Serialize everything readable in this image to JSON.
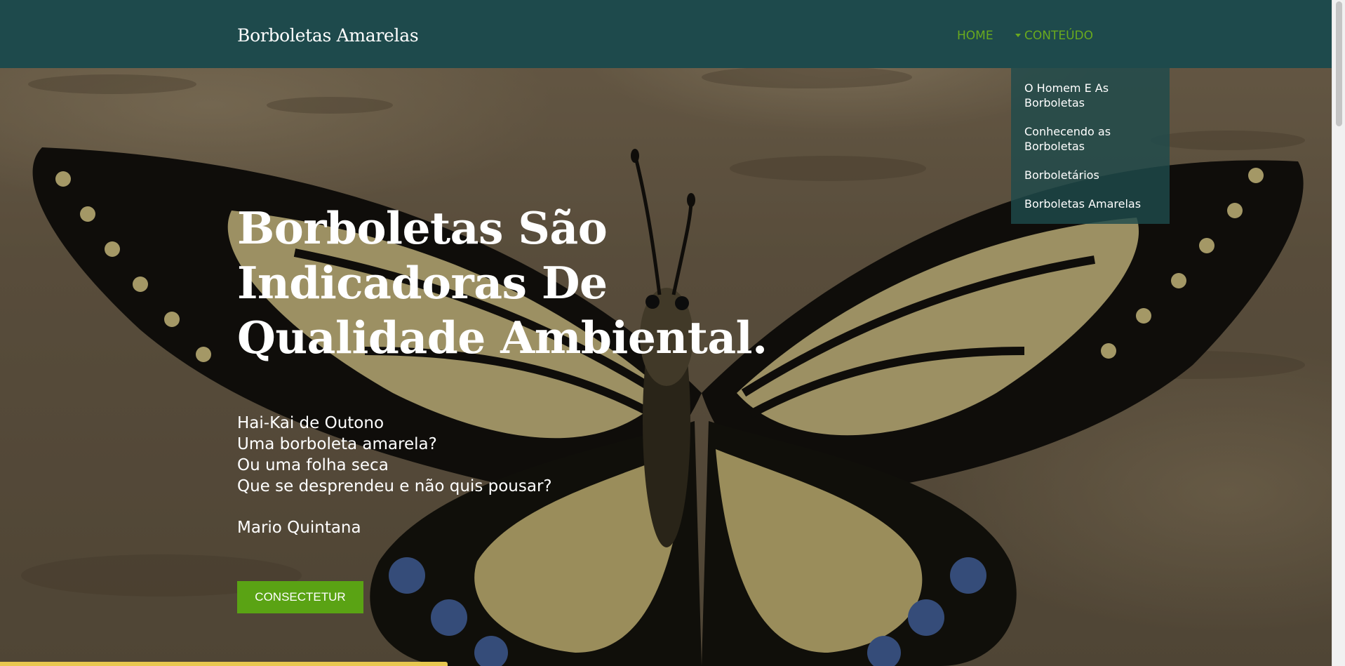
{
  "navbar": {
    "brand": "Borboletas Amarelas",
    "home_label": "HOME",
    "content_label": "CONTEÚDO"
  },
  "dropdown": {
    "items": [
      {
        "label": "O Homem E As Borboletas"
      },
      {
        "label": "Conhecendo as Borboletas"
      },
      {
        "label": "Borboletários"
      },
      {
        "label": "Borboletas Amarelas"
      }
    ]
  },
  "hero": {
    "headline": "Borboletas São Indicadoras De Qualidade Ambiental.",
    "poem_lines": [
      "Hai-Kai de Outono",
      "Uma borboleta amarela?",
      "Ou uma folha seca",
      "Que se desprendeu e não quis pousar?"
    ],
    "author": "Mario Quintana",
    "button_label": "CONSECTETUR"
  },
  "colors": {
    "navbar_bg": "#1e4a4c",
    "nav_link": "#6aaa1e",
    "button_bg": "#5aa314",
    "text": "#ffffff"
  }
}
